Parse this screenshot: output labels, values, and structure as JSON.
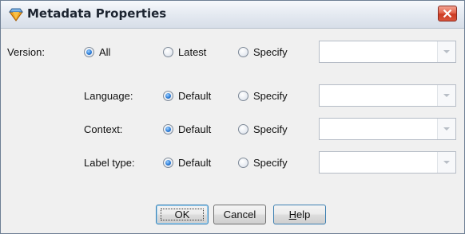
{
  "window": {
    "title": "Metadata Properties"
  },
  "version": {
    "label": "Version:",
    "options": [
      "All",
      "Latest",
      "Specify"
    ],
    "selected": "All",
    "value": ""
  },
  "language": {
    "label": "Language:",
    "options": [
      "Default",
      "Specify"
    ],
    "selected": "Default",
    "value": ""
  },
  "context": {
    "label": "Context:",
    "options": [
      "Default",
      "Specify"
    ],
    "selected": "Default",
    "value": ""
  },
  "label_type": {
    "label": "Label type:",
    "options": [
      "Default",
      "Specify"
    ],
    "selected": "Default",
    "value": ""
  },
  "buttons": {
    "ok": "OK",
    "cancel": "Cancel",
    "help_mnemonic": "H",
    "help_rest": "elp"
  },
  "colors": {
    "accent": "#2f7fd8",
    "close": "#d9563d"
  },
  "icons": {
    "title": "metadata-diamond-icon",
    "close": "close-icon",
    "dropdown": "chevron-down-icon"
  }
}
